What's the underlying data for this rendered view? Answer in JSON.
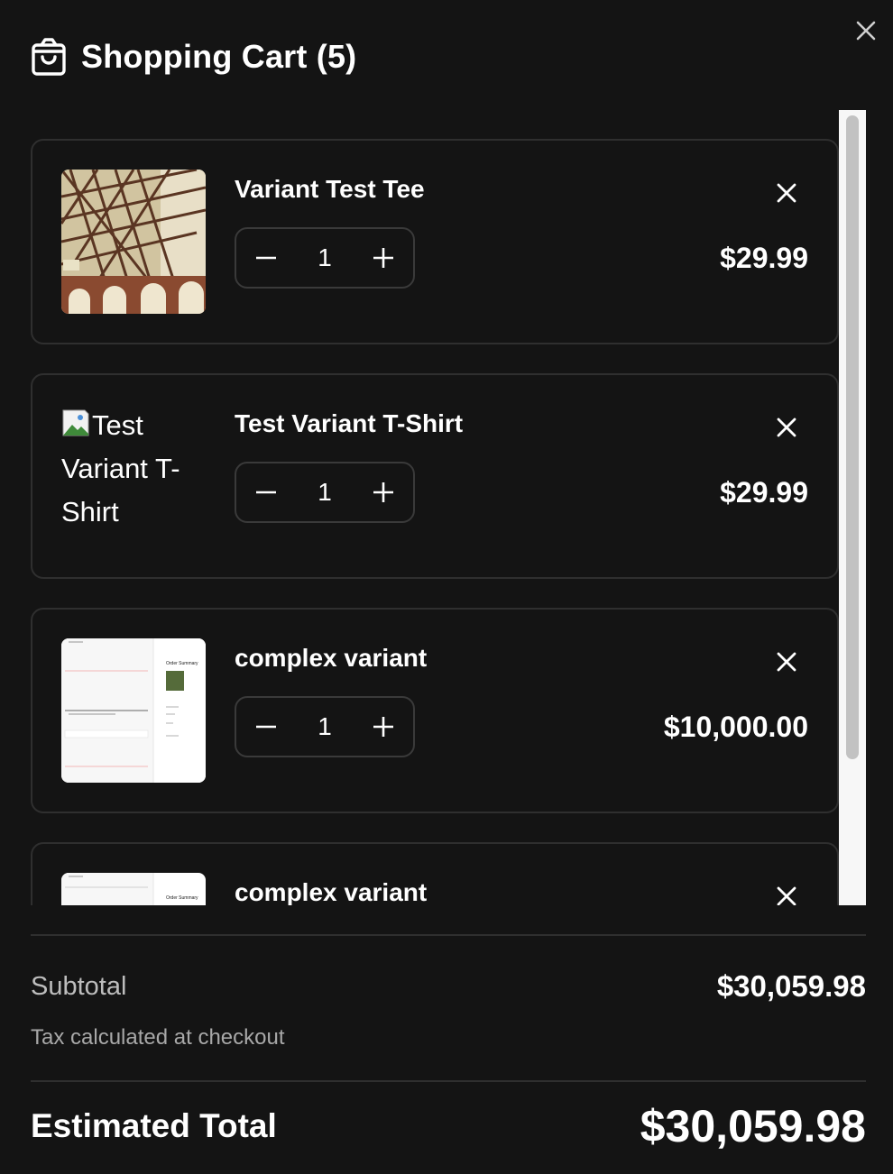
{
  "header": {
    "title": "Shopping Cart (5)",
    "icon": "shopping-bag-icon",
    "close_icon": "close-icon"
  },
  "items": [
    {
      "name": "Variant Test Tee",
      "quantity": "1",
      "price": "$29.99",
      "image": "photo"
    },
    {
      "name": "Test Variant T-Shirt",
      "quantity": "1",
      "price": "$29.99",
      "image": "broken",
      "image_alt": "Test Variant T-Shirt"
    },
    {
      "name": "complex variant",
      "quantity": "1",
      "price": "$10,000.00",
      "image": "screenshot"
    },
    {
      "name": "complex variant",
      "image": "screenshot"
    }
  ],
  "thumbnail_text": {
    "order_summary": "Order Summary"
  },
  "summary": {
    "subtotal_label": "Subtotal",
    "subtotal_value": "$30,059.98",
    "tax_note": "Tax calculated at checkout",
    "total_label": "Estimated Total",
    "total_value": "$30,059.98"
  },
  "colors": {
    "background": "#141414",
    "border": "#2f2f2f",
    "text": "#ffffff",
    "muted": "#bdbdbd",
    "scrollbar_track": "#f7f7f7",
    "scrollbar_thumb": "#c2c2c2"
  }
}
